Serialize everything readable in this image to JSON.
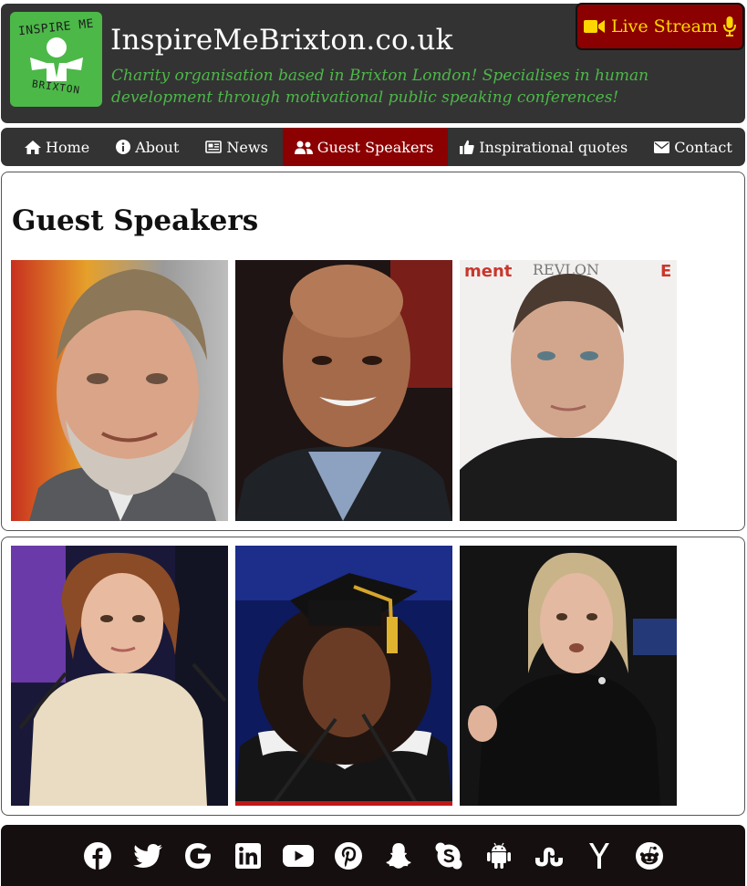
{
  "header": {
    "logo": {
      "top_text": "INSPIRE ME",
      "bottom_text": "BRIXTON"
    },
    "site_title": "InspireMeBrixton.co.uk",
    "tagline": "Charity organisation based in Brixton London! Specialises in human development through motivational public speaking conferences!",
    "live_stream": {
      "label": "Live Stream",
      "icons": [
        "video-camera-icon",
        "microphone-icon"
      ]
    }
  },
  "nav": {
    "items": [
      {
        "label": "Home",
        "icon": "home-icon",
        "active": false
      },
      {
        "label": "About",
        "icon": "info-icon",
        "active": false
      },
      {
        "label": "News",
        "icon": "newspaper-icon",
        "active": false
      },
      {
        "label": "Guest Speakers",
        "icon": "users-icon",
        "active": true
      },
      {
        "label": "Inspirational quotes",
        "icon": "thumbs-up-icon",
        "active": false
      },
      {
        "label": "Contact",
        "icon": "envelope-icon",
        "active": false
      }
    ]
  },
  "main": {
    "title": "Guest Speakers",
    "speakers_row1": [
      {
        "name": "speaker-photo-1"
      },
      {
        "name": "speaker-photo-2"
      },
      {
        "name": "speaker-photo-3"
      }
    ],
    "speakers_row2": [
      {
        "name": "speaker-photo-4"
      },
      {
        "name": "speaker-photo-5"
      },
      {
        "name": "speaker-photo-6"
      }
    ]
  },
  "footer": {
    "social_icons": [
      "facebook-icon",
      "twitter-icon",
      "google-icon",
      "linkedin-icon",
      "youtube-icon",
      "pinterest-icon",
      "snapchat-icon",
      "skype-icon",
      "android-icon",
      "stumbleupon-icon",
      "yahoo-icon",
      "reddit-icon"
    ]
  },
  "colors": {
    "header_bg": "#333333",
    "accent_green": "#4cb848",
    "active_red": "#8b0000",
    "live_text_yellow": "#ffd700",
    "footer_bg": "#150f0f"
  }
}
